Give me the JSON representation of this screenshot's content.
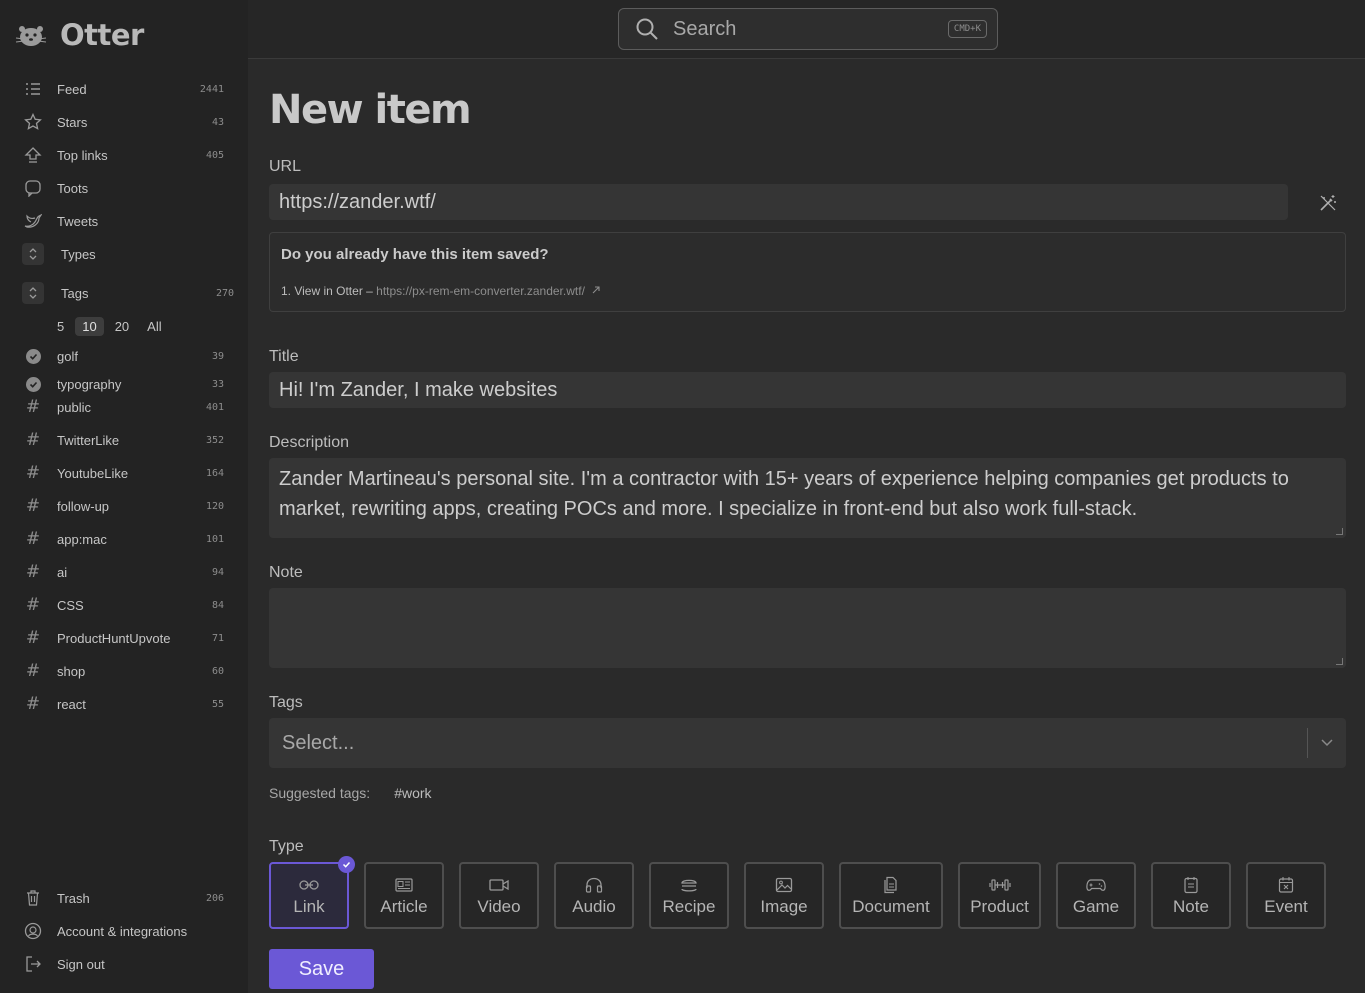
{
  "app": {
    "name": "Otter"
  },
  "search": {
    "placeholder": "Search",
    "shortcut": "CMD+K"
  },
  "sidebar": {
    "nav": [
      {
        "label": "Feed",
        "count": "2441",
        "icon": "list-icon"
      },
      {
        "label": "Stars",
        "count": "43",
        "icon": "star-icon"
      },
      {
        "label": "Top links",
        "count": "405",
        "icon": "upvote-icon"
      },
      {
        "label": "Toots",
        "count": "",
        "icon": "toot-icon"
      },
      {
        "label": "Tweets",
        "count": "",
        "icon": "bird-icon"
      }
    ],
    "types_label": "Types",
    "tags_label": "Tags",
    "tags_count": "270",
    "limits": [
      "5",
      "10",
      "20",
      "All"
    ],
    "limit_active": "10",
    "tags": [
      {
        "label": "golf",
        "count": "39",
        "icon": "check-circle-icon"
      },
      {
        "label": "typography",
        "count": "33",
        "icon": "check-circle-icon"
      },
      {
        "label": "public",
        "count": "401",
        "icon": "hash-icon"
      },
      {
        "label": "TwitterLike",
        "count": "352",
        "icon": "hash-icon"
      },
      {
        "label": "YoutubeLike",
        "count": "164",
        "icon": "hash-icon"
      },
      {
        "label": "follow-up",
        "count": "120",
        "icon": "hash-icon"
      },
      {
        "label": "app:mac",
        "count": "101",
        "icon": "hash-icon"
      },
      {
        "label": "ai",
        "count": "94",
        "icon": "hash-icon"
      },
      {
        "label": "CSS",
        "count": "84",
        "icon": "hash-icon"
      },
      {
        "label": "ProductHuntUpvote",
        "count": "71",
        "icon": "hash-icon"
      },
      {
        "label": "shop",
        "count": "60",
        "icon": "hash-icon"
      },
      {
        "label": "react",
        "count": "55",
        "icon": "hash-icon"
      }
    ],
    "bottom": [
      {
        "label": "Trash",
        "count": "206",
        "icon": "trash-icon"
      },
      {
        "label": "Account & integrations",
        "count": "",
        "icon": "account-icon"
      },
      {
        "label": "Sign out",
        "count": "",
        "icon": "sign-out-icon"
      }
    ]
  },
  "form": {
    "title": "New item",
    "url_label": "URL",
    "url_value": "https://zander.wtf/",
    "saved_question": "Do you already have this item saved?",
    "saved_prefix": "1. View in Otter – ",
    "saved_link": "https://px-rem-em-converter.zander.wtf/",
    "title_label": "Title",
    "title_value": "Hi! I'm Zander, I make websites",
    "description_label": "Description",
    "description_value": "Zander Martineau's personal site. I'm a contractor with 15+ years of experience helping companies get products to market, rewriting apps, creating POCs and more. I specialize in front-end but also work full-stack.",
    "note_label": "Note",
    "note_value": "",
    "tags_label": "Tags",
    "tags_placeholder": "Select...",
    "suggested_label": "Suggested tags:",
    "suggested_tags": [
      "#work"
    ],
    "type_label": "Type",
    "types": [
      "Link",
      "Article",
      "Video",
      "Audio",
      "Recipe",
      "Image",
      "Document",
      "Product",
      "Game",
      "Note",
      "Event"
    ],
    "type_selected": "Link",
    "save_label": "Save"
  },
  "colors": {
    "accent": "#6b58d6",
    "background": "#2a2a2a",
    "sidebar": "#232323"
  }
}
